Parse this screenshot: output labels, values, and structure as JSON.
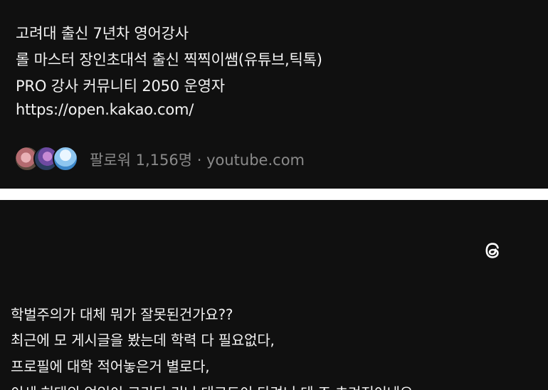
{
  "profile": {
    "bio_lines": [
      "고려대 출신 7년차 영어강사",
      "롤 마스터 장인초대석 출신 찍찍이쌤(유튜브,틱톡)",
      "PRO 강사 커뮤니티 2050 운영자",
      "https://open.kakao.com/"
    ],
    "followers_text": "팔로워 1,156명 · youtube.com"
  },
  "post": {
    "lines": [
      "학벌주의가 대체 뭐가 잘못된건가요??",
      "최근에 모 게시글을 봤는데 학력 다 필요없다,",
      "프로필에 대학 적어놓은거 별로다,",
      "이세 허태의 엉잉이 크리티 리니 대크드이 다려니 데 조 츠겨저이네요"
    ]
  },
  "colors": {
    "panel_bg": "#101010",
    "text": "#f3f3f3",
    "muted": "#8a8a8a",
    "divider": "#ffffff"
  },
  "icons": [
    "threads-logo-icon"
  ]
}
